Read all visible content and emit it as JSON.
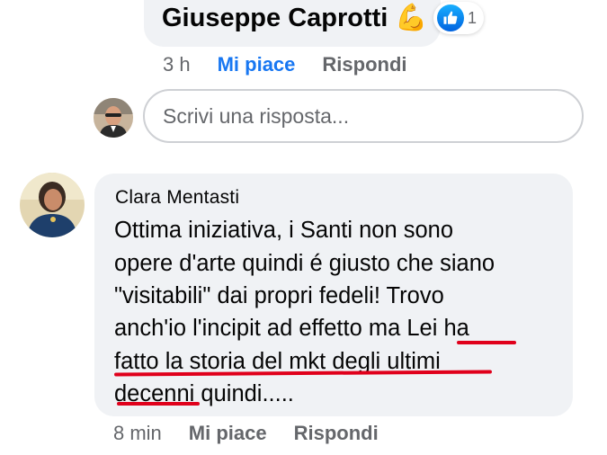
{
  "reply": {
    "author": "Giuseppe Caprotti",
    "emoji": "💪",
    "reaction_count": "1",
    "time": "3 h",
    "like_label": "Mi piace",
    "reply_label": "Rispondi"
  },
  "composer": {
    "placeholder": "Scrivi una risposta..."
  },
  "comment": {
    "author": "Clara Mentasti",
    "lines": [
      "Ottima iniziativa, i Santi non sono",
      "opere d'arte quindi é giusto che siano",
      "\"visitabili\" dai propri fedeli! Trovo",
      "anch'io l'incipit ad effetto ma Lei ha",
      "fatto la storia del mkt degli ultimi",
      "decenni quindi....."
    ],
    "time": "8 min",
    "like_label": "Mi piace",
    "reply_label": "Rispondi"
  },
  "colors": {
    "bubble": "#f0f2f5",
    "liked": "#1877f2",
    "meta": "#65676b",
    "annotation_underline": "#e0001b"
  },
  "icons": {
    "reaction": "thumbs-up-icon"
  }
}
